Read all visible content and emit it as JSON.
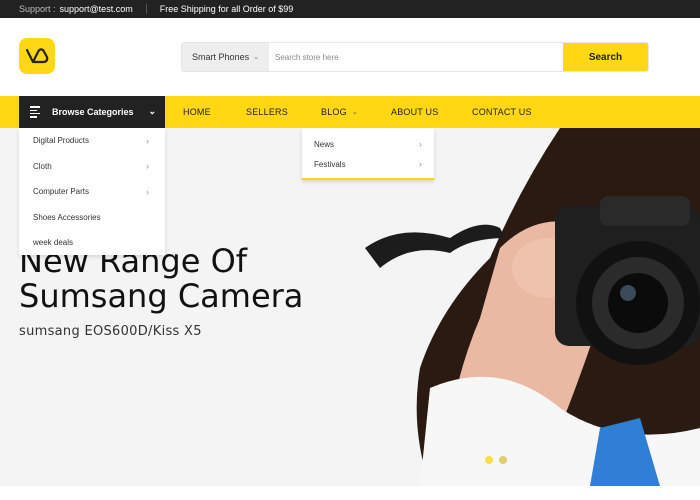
{
  "topbar": {
    "support_label": "Support :",
    "support_email": "support@test.com",
    "shipping_text": "Free Shipping for all Order of $99"
  },
  "header": {
    "logo_icon": "logo-icon",
    "search": {
      "category": "Smart Phones",
      "placeholder": "Search store here",
      "button_label": "Search"
    }
  },
  "nav": {
    "browse_label": "Browse Categories",
    "items": [
      "HOME",
      "SELLERS",
      "BLOG",
      "ABOUT US",
      "CONTACT US"
    ]
  },
  "categories": [
    "Digital Products",
    "Cloth",
    "Computer Parts",
    "Shoes Accessories",
    "week deals"
  ],
  "blog_menu": [
    "News",
    "Festivals"
  ],
  "hero": {
    "title_line1": "New Range Of",
    "title_line2": "Sumsang Camera",
    "subtitle": "sumsang EOS600D/Kiss X5"
  },
  "colors": {
    "accent": "#ffd813",
    "dark": "#222222"
  }
}
